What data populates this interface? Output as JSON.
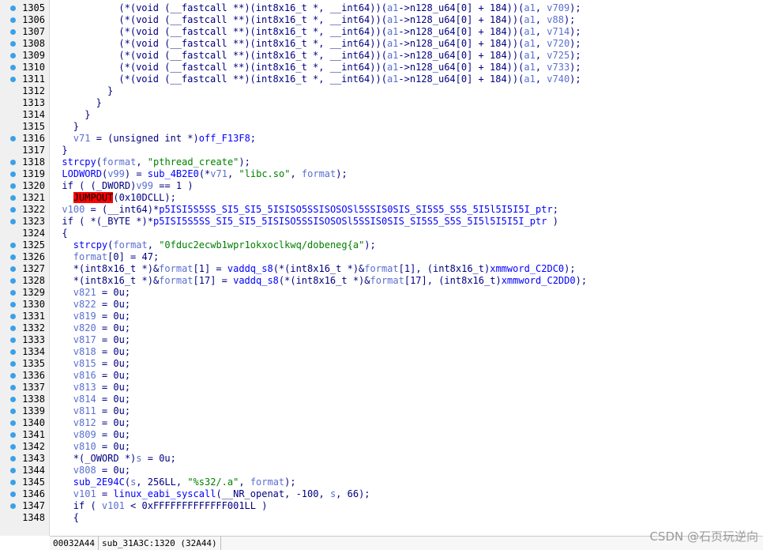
{
  "status_bar": {
    "address": "00032A44",
    "location": "sub_31A3C:1320 (32A44)"
  },
  "watermark": "CSDN @石页玩逆向",
  "lines": [
    {
      "num": "1305",
      "dot": true,
      "indent": 6,
      "parts": [
        [
          "",
          "(*(void (__fastcall **)(int8x16_t *, __int64))("
        ],
        [
          "var",
          "a1"
        ],
        [
          "",
          "->n128_u64[0] + 184))("
        ],
        [
          "var",
          "a1"
        ],
        [
          "",
          ", "
        ],
        [
          "var",
          "v709"
        ],
        [
          "",
          ");"
        ]
      ]
    },
    {
      "num": "1306",
      "dot": true,
      "indent": 6,
      "parts": [
        [
          "",
          "(*(void (__fastcall **)(int8x16_t *, __int64))("
        ],
        [
          "var",
          "a1"
        ],
        [
          "",
          "->n128_u64[0] + 184))("
        ],
        [
          "var",
          "a1"
        ],
        [
          "",
          ", "
        ],
        [
          "var",
          "v88"
        ],
        [
          "",
          ");"
        ]
      ]
    },
    {
      "num": "1307",
      "dot": true,
      "indent": 6,
      "parts": [
        [
          "",
          "(*(void (__fastcall **)(int8x16_t *, __int64))("
        ],
        [
          "var",
          "a1"
        ],
        [
          "",
          "->n128_u64[0] + 184))("
        ],
        [
          "var",
          "a1"
        ],
        [
          "",
          ", "
        ],
        [
          "var",
          "v714"
        ],
        [
          "",
          ");"
        ]
      ]
    },
    {
      "num": "1308",
      "dot": true,
      "indent": 6,
      "parts": [
        [
          "",
          "(*(void (__fastcall **)(int8x16_t *, __int64))("
        ],
        [
          "var",
          "a1"
        ],
        [
          "",
          "->n128_u64[0] + 184))("
        ],
        [
          "var",
          "a1"
        ],
        [
          "",
          ", "
        ],
        [
          "var",
          "v720"
        ],
        [
          "",
          ");"
        ]
      ]
    },
    {
      "num": "1309",
      "dot": true,
      "indent": 6,
      "parts": [
        [
          "",
          "(*(void (__fastcall **)(int8x16_t *, __int64))("
        ],
        [
          "var",
          "a1"
        ],
        [
          "",
          "->n128_u64[0] + 184))("
        ],
        [
          "var",
          "a1"
        ],
        [
          "",
          ", "
        ],
        [
          "var",
          "v725"
        ],
        [
          "",
          ");"
        ]
      ]
    },
    {
      "num": "1310",
      "dot": true,
      "indent": 6,
      "parts": [
        [
          "",
          "(*(void (__fastcall **)(int8x16_t *, __int64))("
        ],
        [
          "var",
          "a1"
        ],
        [
          "",
          "->n128_u64[0] + 184))("
        ],
        [
          "var",
          "a1"
        ],
        [
          "",
          ", "
        ],
        [
          "var",
          "v733"
        ],
        [
          "",
          ");"
        ]
      ]
    },
    {
      "num": "1311",
      "dot": true,
      "indent": 6,
      "parts": [
        [
          "",
          "(*(void (__fastcall **)(int8x16_t *, __int64))("
        ],
        [
          "var",
          "a1"
        ],
        [
          "",
          "->n128_u64[0] + 184))("
        ],
        [
          "var",
          "a1"
        ],
        [
          "",
          ", "
        ],
        [
          "var",
          "v740"
        ],
        [
          "",
          ");"
        ]
      ]
    },
    {
      "num": "1312",
      "dot": false,
      "indent": 5,
      "parts": [
        [
          "",
          "}"
        ]
      ]
    },
    {
      "num": "1313",
      "dot": false,
      "indent": 4,
      "parts": [
        [
          "",
          "}"
        ]
      ]
    },
    {
      "num": "1314",
      "dot": false,
      "indent": 3,
      "parts": [
        [
          "",
          "}"
        ]
      ]
    },
    {
      "num": "1315",
      "dot": false,
      "indent": 2,
      "parts": [
        [
          "",
          "}"
        ]
      ]
    },
    {
      "num": "1316",
      "dot": true,
      "indent": 2,
      "parts": [
        [
          "var",
          "v71"
        ],
        [
          "",
          " = (unsigned int *)"
        ],
        [
          "id",
          "off_F13F8"
        ],
        [
          "",
          ";"
        ]
      ]
    },
    {
      "num": "1317",
      "dot": false,
      "indent": 1,
      "parts": [
        [
          "",
          "}"
        ]
      ]
    },
    {
      "num": "1318",
      "dot": true,
      "indent": 1,
      "parts": [
        [
          "id",
          "strcpy"
        ],
        [
          "",
          "("
        ],
        [
          "var",
          "format"
        ],
        [
          "",
          ", "
        ],
        [
          "str",
          "\"pthread_create\""
        ],
        [
          "",
          ");"
        ]
      ]
    },
    {
      "num": "1319",
      "dot": true,
      "indent": 1,
      "parts": [
        [
          "id",
          "LODWORD"
        ],
        [
          "",
          "("
        ],
        [
          "var",
          "v99"
        ],
        [
          "",
          ") = "
        ],
        [
          "id",
          "sub_4B2E0"
        ],
        [
          "",
          "(*"
        ],
        [
          "var",
          "v71"
        ],
        [
          "",
          ", "
        ],
        [
          "str",
          "\"libc.so\""
        ],
        [
          "",
          ", "
        ],
        [
          "var",
          "format"
        ],
        [
          "",
          ");"
        ]
      ]
    },
    {
      "num": "1320",
      "dot": true,
      "indent": 1,
      "hl": true,
      "parts": [
        [
          "",
          "if ( (_DWORD)"
        ],
        [
          "var",
          "v99"
        ],
        [
          "",
          " == 1 )"
        ]
      ]
    },
    {
      "num": "1321",
      "dot": true,
      "indent": 2,
      "parts": [
        [
          "jump",
          "JUMPOUT"
        ],
        [
          "",
          "(0x10DCLL);"
        ]
      ]
    },
    {
      "num": "1322",
      "dot": true,
      "indent": 1,
      "parts": [
        [
          "var",
          "v100"
        ],
        [
          "",
          " = (__int64)*"
        ],
        [
          "id",
          "p5ISI5S5SS_SI5_SI5_5ISISO5SSISOSOSl5SSIS0SIS_SI5S5_S5S_5I5l5I5I5I_ptr"
        ],
        [
          "",
          ";"
        ]
      ]
    },
    {
      "num": "1323",
      "dot": true,
      "indent": 1,
      "parts": [
        [
          "",
          "if ( *(_BYTE *)*"
        ],
        [
          "id",
          "p5ISI5S5SS_SI5_SI5_5ISISO5SSISOSOSl5SSIS0SIS_SI5S5_S5S_5I5l5I5I5I_ptr"
        ],
        [
          "",
          " )"
        ]
      ]
    },
    {
      "num": "1324",
      "dot": false,
      "indent": 1,
      "parts": [
        [
          "",
          "{"
        ]
      ]
    },
    {
      "num": "1325",
      "dot": true,
      "indent": 2,
      "parts": [
        [
          "id",
          "strcpy"
        ],
        [
          "",
          "("
        ],
        [
          "var",
          "format"
        ],
        [
          "",
          ", "
        ],
        [
          "str",
          "\"0fduc2ecwb1wpr1okxoclkwq/dobeneg{a\""
        ],
        [
          "",
          ");"
        ]
      ]
    },
    {
      "num": "1326",
      "dot": true,
      "indent": 2,
      "parts": [
        [
          "var",
          "format"
        ],
        [
          "",
          "[0] = 47;"
        ]
      ]
    },
    {
      "num": "1327",
      "dot": true,
      "indent": 2,
      "parts": [
        [
          "",
          "*(int8x16_t *)&"
        ],
        [
          "var",
          "format"
        ],
        [
          "",
          "[1] = "
        ],
        [
          "id",
          "vaddq_s8"
        ],
        [
          "",
          "(*(int8x16_t *)&"
        ],
        [
          "var",
          "format"
        ],
        [
          "",
          "[1], (int8x16_t)"
        ],
        [
          "id",
          "xmmword_C2DC0"
        ],
        [
          "",
          ");"
        ]
      ]
    },
    {
      "num": "1328",
      "dot": true,
      "indent": 2,
      "parts": [
        [
          "",
          "*(int8x16_t *)&"
        ],
        [
          "var",
          "format"
        ],
        [
          "",
          "[17] = "
        ],
        [
          "id",
          "vaddq_s8"
        ],
        [
          "",
          "(*(int8x16_t *)&"
        ],
        [
          "var",
          "format"
        ],
        [
          "",
          "[17], (int8x16_t)"
        ],
        [
          "id",
          "xmmword_C2DD0"
        ],
        [
          "",
          ");"
        ]
      ]
    },
    {
      "num": "1329",
      "dot": true,
      "indent": 2,
      "parts": [
        [
          "var",
          "v821"
        ],
        [
          "",
          " = 0u;"
        ]
      ]
    },
    {
      "num": "1330",
      "dot": true,
      "indent": 2,
      "parts": [
        [
          "var",
          "v822"
        ],
        [
          "",
          " = 0u;"
        ]
      ]
    },
    {
      "num": "1331",
      "dot": true,
      "indent": 2,
      "parts": [
        [
          "var",
          "v819"
        ],
        [
          "",
          " = 0u;"
        ]
      ]
    },
    {
      "num": "1332",
      "dot": true,
      "indent": 2,
      "parts": [
        [
          "var",
          "v820"
        ],
        [
          "",
          " = 0u;"
        ]
      ]
    },
    {
      "num": "1333",
      "dot": true,
      "indent": 2,
      "parts": [
        [
          "var",
          "v817"
        ],
        [
          "",
          " = 0u;"
        ]
      ]
    },
    {
      "num": "1334",
      "dot": true,
      "indent": 2,
      "parts": [
        [
          "var",
          "v818"
        ],
        [
          "",
          " = 0u;"
        ]
      ]
    },
    {
      "num": "1335",
      "dot": true,
      "indent": 2,
      "parts": [
        [
          "var",
          "v815"
        ],
        [
          "",
          " = 0u;"
        ]
      ]
    },
    {
      "num": "1336",
      "dot": true,
      "indent": 2,
      "parts": [
        [
          "var",
          "v816"
        ],
        [
          "",
          " = 0u;"
        ]
      ]
    },
    {
      "num": "1337",
      "dot": true,
      "indent": 2,
      "parts": [
        [
          "var",
          "v813"
        ],
        [
          "",
          " = 0u;"
        ]
      ]
    },
    {
      "num": "1338",
      "dot": true,
      "indent": 2,
      "parts": [
        [
          "var",
          "v814"
        ],
        [
          "",
          " = 0u;"
        ]
      ]
    },
    {
      "num": "1339",
      "dot": true,
      "indent": 2,
      "parts": [
        [
          "var",
          "v811"
        ],
        [
          "",
          " = 0u;"
        ]
      ]
    },
    {
      "num": "1340",
      "dot": true,
      "indent": 2,
      "parts": [
        [
          "var",
          "v812"
        ],
        [
          "",
          " = 0u;"
        ]
      ]
    },
    {
      "num": "1341",
      "dot": true,
      "indent": 2,
      "parts": [
        [
          "var",
          "v809"
        ],
        [
          "",
          " = 0u;"
        ]
      ]
    },
    {
      "num": "1342",
      "dot": true,
      "indent": 2,
      "parts": [
        [
          "var",
          "v810"
        ],
        [
          "",
          " = 0u;"
        ]
      ]
    },
    {
      "num": "1343",
      "dot": true,
      "indent": 2,
      "parts": [
        [
          "",
          "*(_OWORD *)"
        ],
        [
          "var",
          "s"
        ],
        [
          "",
          " = 0u;"
        ]
      ]
    },
    {
      "num": "1344",
      "dot": true,
      "indent": 2,
      "parts": [
        [
          "var",
          "v808"
        ],
        [
          "",
          " = 0u;"
        ]
      ]
    },
    {
      "num": "1345",
      "dot": true,
      "indent": 2,
      "parts": [
        [
          "id",
          "sub_2E94C"
        ],
        [
          "",
          "("
        ],
        [
          "var",
          "s"
        ],
        [
          "",
          ", 256LL, "
        ],
        [
          "str",
          "\"%s32/.a\""
        ],
        [
          "",
          ", "
        ],
        [
          "var",
          "format"
        ],
        [
          "",
          ");"
        ]
      ]
    },
    {
      "num": "1346",
      "dot": true,
      "indent": 2,
      "parts": [
        [
          "var",
          "v101"
        ],
        [
          "",
          " = "
        ],
        [
          "id",
          "linux_eabi_syscall"
        ],
        [
          "",
          "(__NR_openat, -100, "
        ],
        [
          "var",
          "s"
        ],
        [
          "",
          ", 66);"
        ]
      ]
    },
    {
      "num": "1347",
      "dot": true,
      "indent": 2,
      "parts": [
        [
          "",
          "if ( "
        ],
        [
          "var",
          "v101"
        ],
        [
          "",
          " < 0xFFFFFFFFFFFFF001LL )"
        ]
      ]
    },
    {
      "num": "1348",
      "dot": false,
      "indent": 2,
      "parts": [
        [
          "",
          "{"
        ]
      ]
    }
  ]
}
